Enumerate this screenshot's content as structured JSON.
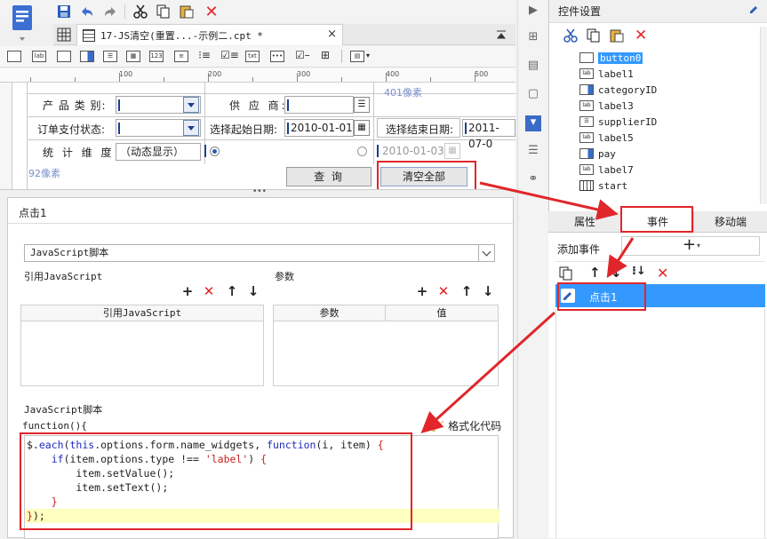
{
  "toolbar": {
    "save": "save-icon",
    "undo": "undo-icon",
    "redo": "redo-icon",
    "cut": "cut-icon",
    "copy": "copy-icon",
    "paste": "paste-icon",
    "delete": "delete-icon"
  },
  "doc_tab": {
    "title": "17-JS清空(重置...-示例二.cpt *",
    "close": "×"
  },
  "ruler": {
    "marks": [
      "100",
      "200",
      "300",
      "400",
      "500"
    ]
  },
  "form": {
    "product_category_label": "产 品 类 别:",
    "supplier_label": "供 应 商:",
    "payment_status_label": "订单支付状态:",
    "start_date_label": "选择起始日期:",
    "start_date_value": "2010-01-01",
    "end_date_label": "选择结束日期:",
    "end_date_value": "2011-07-0",
    "dimension_label": "统 计 维 度:",
    "dimension_value": "（动态显示）",
    "disabled_date": "2010-01-03",
    "width_note": "401像素",
    "height_note": "92像素",
    "query_button": "查 询",
    "clear_button": "清空全部"
  },
  "event_editor": {
    "title": "点击1",
    "script_type": "JavaScript脚本",
    "ref_js_label": "引用JavaScript",
    "params_label": "参数",
    "ref_js_column": "引用JavaScript",
    "param_column": "参数",
    "value_column": "值",
    "script_label": "JavaScript脚本",
    "function_header": "function(){",
    "format_code": "格式化代码"
  },
  "code_lines": [
    "$.each(this.options.form.name_widgets, function(i, item) {",
    "    if(item.options.type !== 'label') {",
    "        item.setValue();",
    "        item.setText();",
    "    }",
    "});"
  ],
  "control_settings": {
    "title": "控件设置",
    "items": [
      "button0",
      "label1",
      "categoryID",
      "label3",
      "supplierID",
      "label5",
      "pay",
      "label7",
      "start"
    ]
  },
  "prop_tabs": {
    "properties": "属性",
    "events": "事件",
    "mobile": "移动端"
  },
  "event_panel": {
    "add_event": "添加事件",
    "event_item": "点击1"
  },
  "colors": {
    "accent_red": "#e0262b",
    "selection_blue": "#3399ff"
  }
}
